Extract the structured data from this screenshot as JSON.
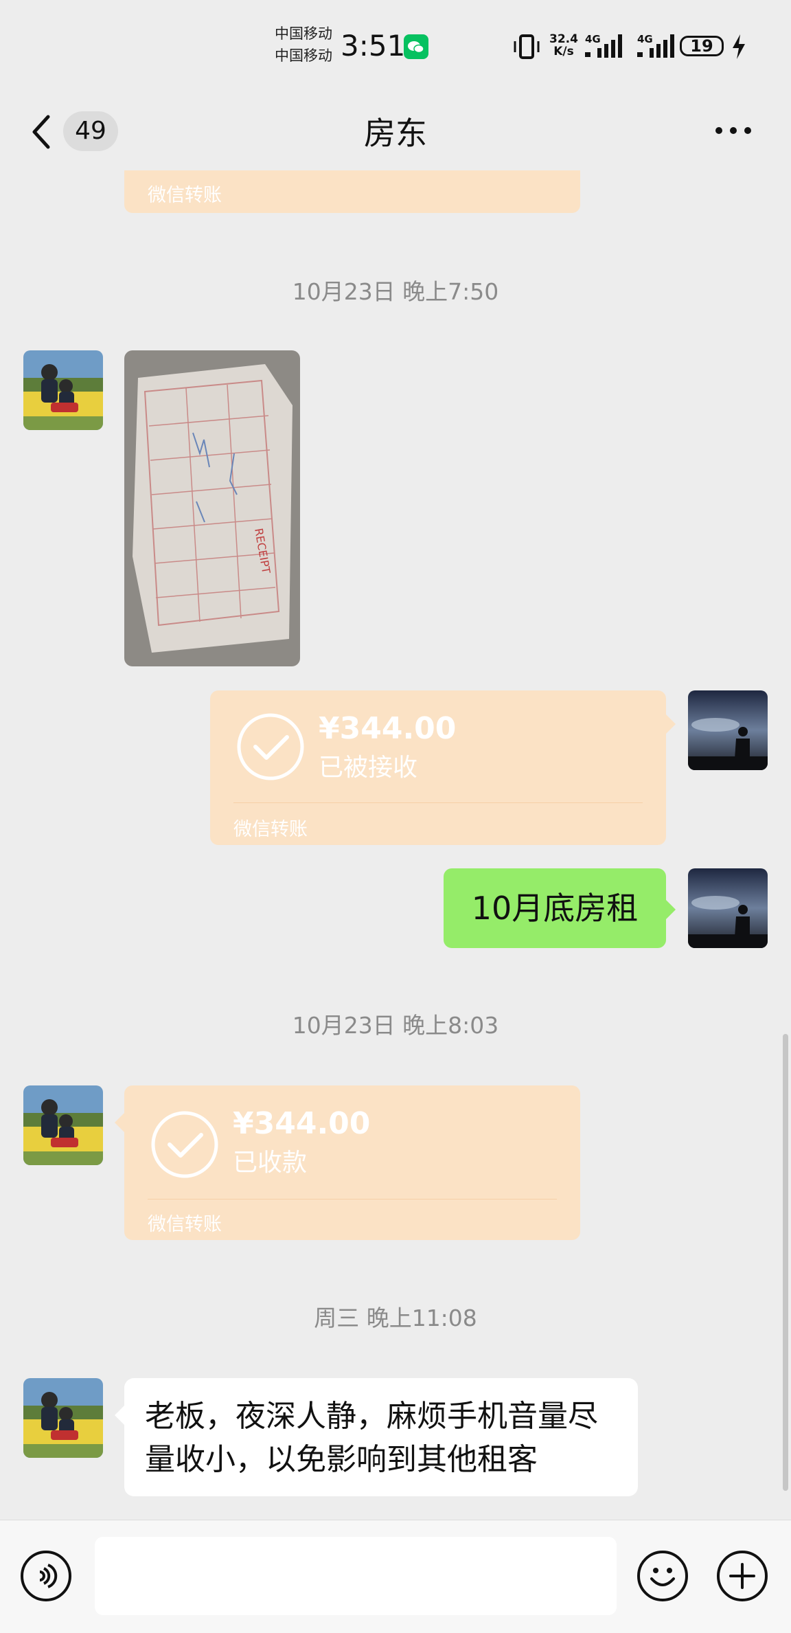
{
  "status_bar": {
    "carrier_1": "中国移动",
    "carrier_2": "中国移动",
    "time": "3:51",
    "speed_value": "32.4",
    "speed_unit": "K/s",
    "network_1": "4G",
    "network_2": "4G",
    "battery": "19",
    "icons": [
      "wechat-icon",
      "vibrate-icon",
      "signal-icon",
      "signal-icon",
      "battery-icon",
      "charging-icon"
    ]
  },
  "nav": {
    "unread_count": "49",
    "title": "房东",
    "icons": [
      "back-chevron-icon",
      "more-icon"
    ]
  },
  "chat": {
    "top_partial_transfer_label": "微信转账",
    "timestamp_1": "10月23日 晚上7:50",
    "outgoing_transfer": {
      "amount": "¥344.00",
      "status": "已被接收",
      "label": "微信转账"
    },
    "outgoing_text": "10月底房租",
    "timestamp_2": "10月23日 晚上8:03",
    "incoming_transfer": {
      "amount": "¥344.00",
      "status": "已收款",
      "label": "微信转账"
    },
    "timestamp_3": "周三 晚上11:08",
    "incoming_text": "老板，夜深人静，麻烦手机音量尽量收小，以免影响到其他租客"
  },
  "input_bar": {
    "value": "",
    "icons": [
      "voice-icon",
      "emoji-icon",
      "plus-icon"
    ]
  },
  "colors": {
    "background": "#ededed",
    "transfer_bubble": "#fbe2c5",
    "green_bubble": "#95ec69",
    "white_bubble": "#ffffff"
  }
}
